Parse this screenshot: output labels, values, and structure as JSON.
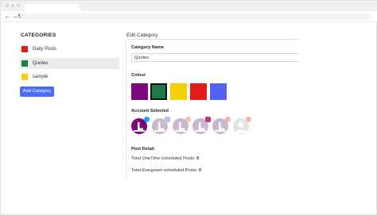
{
  "browser": {
    "back_glyph": "←",
    "forward_glyph": "→",
    "reload_glyph": "↻"
  },
  "sidebar": {
    "title": "CATEGORIES",
    "items": [
      {
        "label": "Daily Posts",
        "color": "#e31b1b"
      },
      {
        "label": "Quotes",
        "color": "#1f7a4a"
      },
      {
        "label": "sample",
        "color": "#f5d000"
      }
    ],
    "add_button": "Add Category"
  },
  "editor": {
    "title": "Edit Category",
    "name_label": "Category Name",
    "name_value": "Quotes",
    "colour_label": "Colour",
    "colours": [
      "#7b0a7e",
      "#1f7a4a",
      "#f5d000",
      "#e31b1b",
      "#5163f2"
    ],
    "selected_colour_index": 1,
    "account_label": "Account Selected",
    "accounts": [
      {
        "network_icon": "twitter-icon",
        "selected": true
      },
      {
        "network_icon": "facebook-icon",
        "selected": false
      },
      {
        "network_icon": "linkedin-icon",
        "selected": false
      },
      {
        "network_icon": "instagram-icon",
        "selected": false
      },
      {
        "network_icon": "pinterest-icon",
        "selected": false
      },
      {
        "network_icon": "pinterest-icon",
        "selected": false
      }
    ],
    "post_detail_label": "Post Detail",
    "onetime_prefix": "Total ",
    "onetime_em": "OneTime",
    "onetime_suffix": " scheduled Posts: ",
    "onetime_count": "0",
    "evergreen_prefix": "Total ",
    "evergreen_em": "Evergreen",
    "evergreen_suffix": " scheduled Posts: ",
    "evergreen_count": "0"
  }
}
